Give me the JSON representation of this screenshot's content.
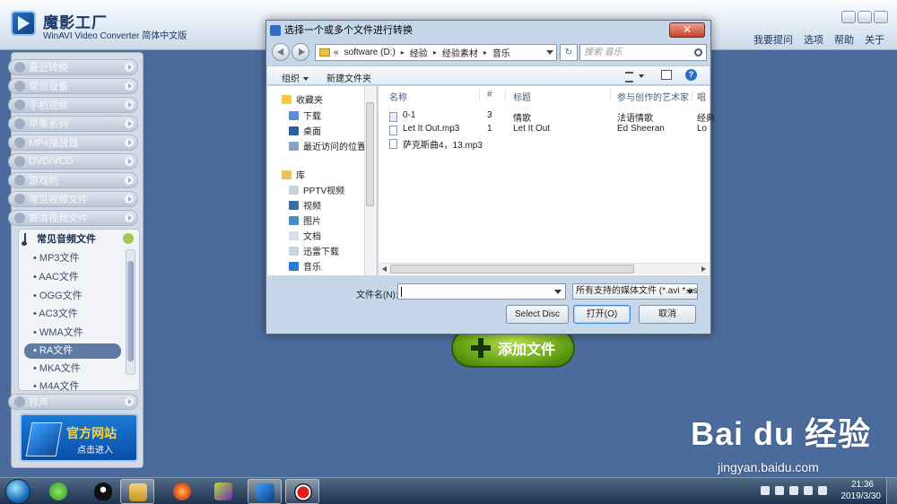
{
  "app": {
    "title": "魔影工厂",
    "subtitle": "WinAVI Video Converter 简体中文版",
    "menu": [
      "我要提问",
      "选项",
      "帮助",
      "关于"
    ]
  },
  "sidebar": {
    "categories": [
      "最近转换",
      "常见设备",
      "手机视频",
      "苹果系列",
      "MP4播放器",
      "DVD/VCD",
      "游戏机",
      "常见视频文件",
      "高清视频文件"
    ],
    "expanded": {
      "label": "常见音频文件",
      "formats": [
        "• MP3文件",
        "• AAC文件",
        "• OGG文件",
        "• AC3文件",
        "• WMA文件",
        "• RA文件",
        "• MKA文件",
        "• M4A文件"
      ],
      "selected_index": 5
    },
    "bottom_category": "铃声",
    "banner": {
      "title": "官方网站",
      "subtitle": "点击进入"
    }
  },
  "add_file_button": "添加文件",
  "dialog": {
    "title": "选择一个或多个文件进行转换",
    "address": {
      "prefix": "«",
      "crumbs": [
        "software (D:)",
        "经验",
        "经验素材",
        "音乐"
      ]
    },
    "search_placeholder": "搜索 音乐",
    "toolbar": {
      "organize": "组织",
      "new_folder": "新建文件夹"
    },
    "nav": {
      "favorites_header": "收藏夹",
      "favorites": [
        "下载",
        "桌面",
        "最近访问的位置"
      ],
      "libraries_header": "库",
      "libraries": [
        "PPTV视频",
        "视频",
        "图片",
        "文档",
        "迅雷下载",
        "音乐"
      ]
    },
    "columns": [
      "名称",
      "#",
      "标题",
      "参与创作的艺术家",
      "唱"
    ],
    "files": [
      {
        "name": "0-1",
        "num": "3",
        "title": "情歌",
        "artist": "法语情歌",
        "extra": "经典"
      },
      {
        "name": "Let It Out.mp3",
        "num": "1",
        "title": "Let It Out",
        "artist": "Ed Sheeran",
        "extra": "Lo"
      },
      {
        "name": "萨克斯曲4，13.mp3",
        "num": "",
        "title": "",
        "artist": "",
        "extra": ""
      }
    ],
    "filename_label": "文件名(N):",
    "filename_value": "",
    "filetype": "所有支持的媒体文件 (*.avi *.as",
    "buttons": {
      "select_disc": "Select Disc",
      "open": "打开(O)",
      "cancel": "取消"
    }
  },
  "watermark": {
    "brand": "Bai du 经验",
    "url": "jingyan.baidu.com"
  },
  "taskbar": {
    "apps": [
      "360-icon",
      "qq-icon",
      "explorer-icon",
      "firefox-icon",
      "video-app-icon",
      "winavi-icon",
      "recorder-icon"
    ],
    "time": "21:36",
    "date": "2019/3/30"
  },
  "colors": {
    "accent_green": "#5c9d10",
    "selection": "#5f7aa3",
    "window_bg": "#4b6b9c"
  }
}
